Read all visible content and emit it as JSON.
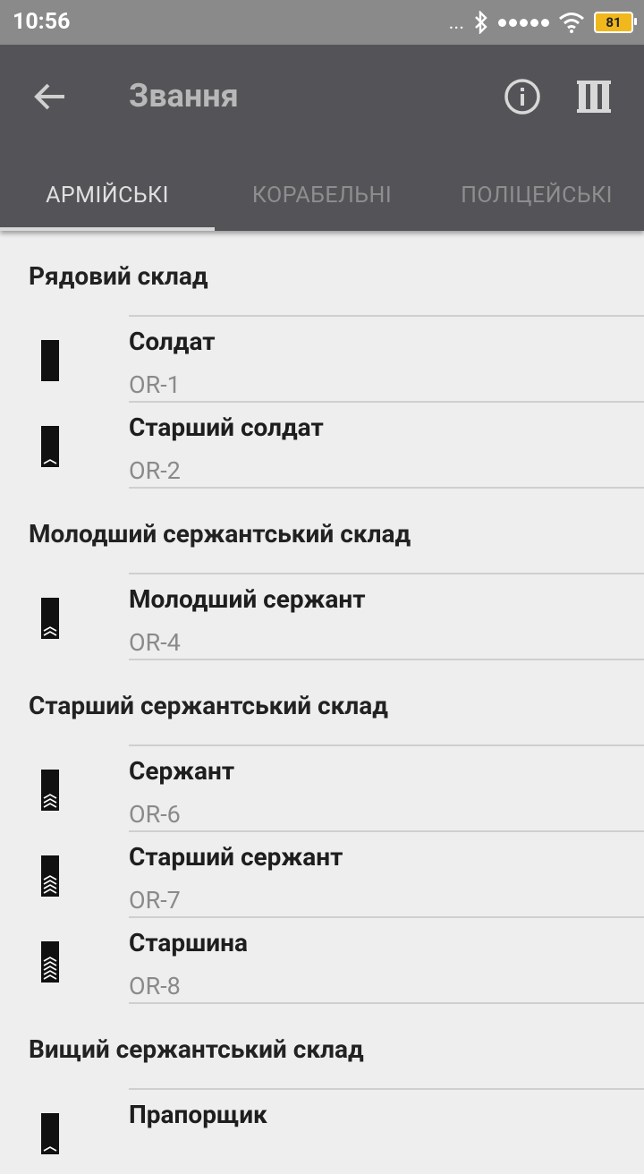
{
  "status_bar": {
    "time": "10:56",
    "more": "...",
    "battery": "81"
  },
  "appbar": {
    "title": "Звання"
  },
  "tabs": [
    {
      "label": "АРМІЙСЬКІ",
      "active": true
    },
    {
      "label": "КОРАБЕЛЬНІ",
      "active": false
    },
    {
      "label": "ПОЛІЦЕЙСЬКІ",
      "active": false
    }
  ],
  "sections": [
    {
      "title": "Рядовий склад",
      "items": [
        {
          "name": "Солдат",
          "code": "OR-1",
          "stripes": 0
        },
        {
          "name": "Старший солдат",
          "code": "OR-2",
          "stripes": 1
        }
      ]
    },
    {
      "title": "Молодший сержантський склад",
      "items": [
        {
          "name": "Молодший сержант",
          "code": "OR-4",
          "stripes": 2
        }
      ]
    },
    {
      "title": "Старший сержантський склад",
      "items": [
        {
          "name": "Сержант",
          "code": "OR-6",
          "stripes": 3
        },
        {
          "name": "Старший сержант",
          "code": "OR-7",
          "stripes": 4
        },
        {
          "name": "Старшина",
          "code": "OR-8",
          "stripes": 5
        }
      ]
    },
    {
      "title": "Вищий сержантський склад",
      "items": [
        {
          "name": "Прапорщик",
          "code": "",
          "stripes": 1
        }
      ]
    }
  ],
  "colors": {
    "appbar": "#545458",
    "statusbar": "#8a8a8a",
    "background": "#eeeeee",
    "battery": "#f0b81c"
  }
}
